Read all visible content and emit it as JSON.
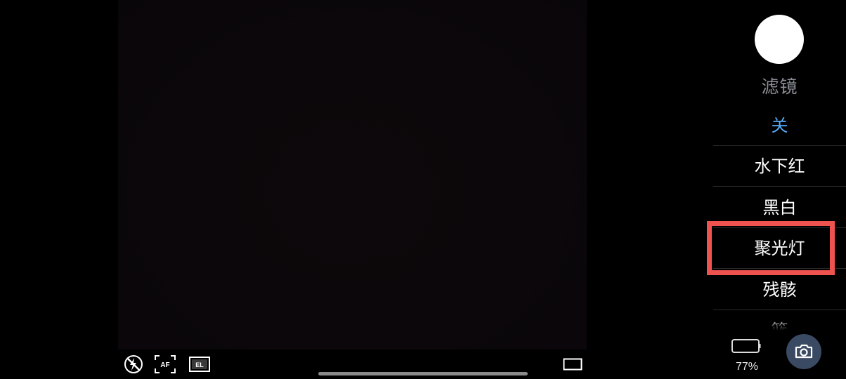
{
  "filter_panel": {
    "title": "滤镜",
    "items": [
      {
        "label": "关",
        "selected": true
      },
      {
        "label": "水下红",
        "selected": false
      },
      {
        "label": "黑白",
        "selected": false
      },
      {
        "label": "聚光灯",
        "selected": false,
        "highlighted": true
      },
      {
        "label": "残骸",
        "selected": false
      },
      {
        "label": "篮",
        "selected": false
      }
    ]
  },
  "status": {
    "battery_percent": "77%"
  },
  "toolbar": {
    "af_label": "AF",
    "el_label": "EL"
  },
  "colors": {
    "selected_item": "#5aabf5",
    "highlight_box": "#ef5350",
    "camera_button": "#3a4a63"
  }
}
